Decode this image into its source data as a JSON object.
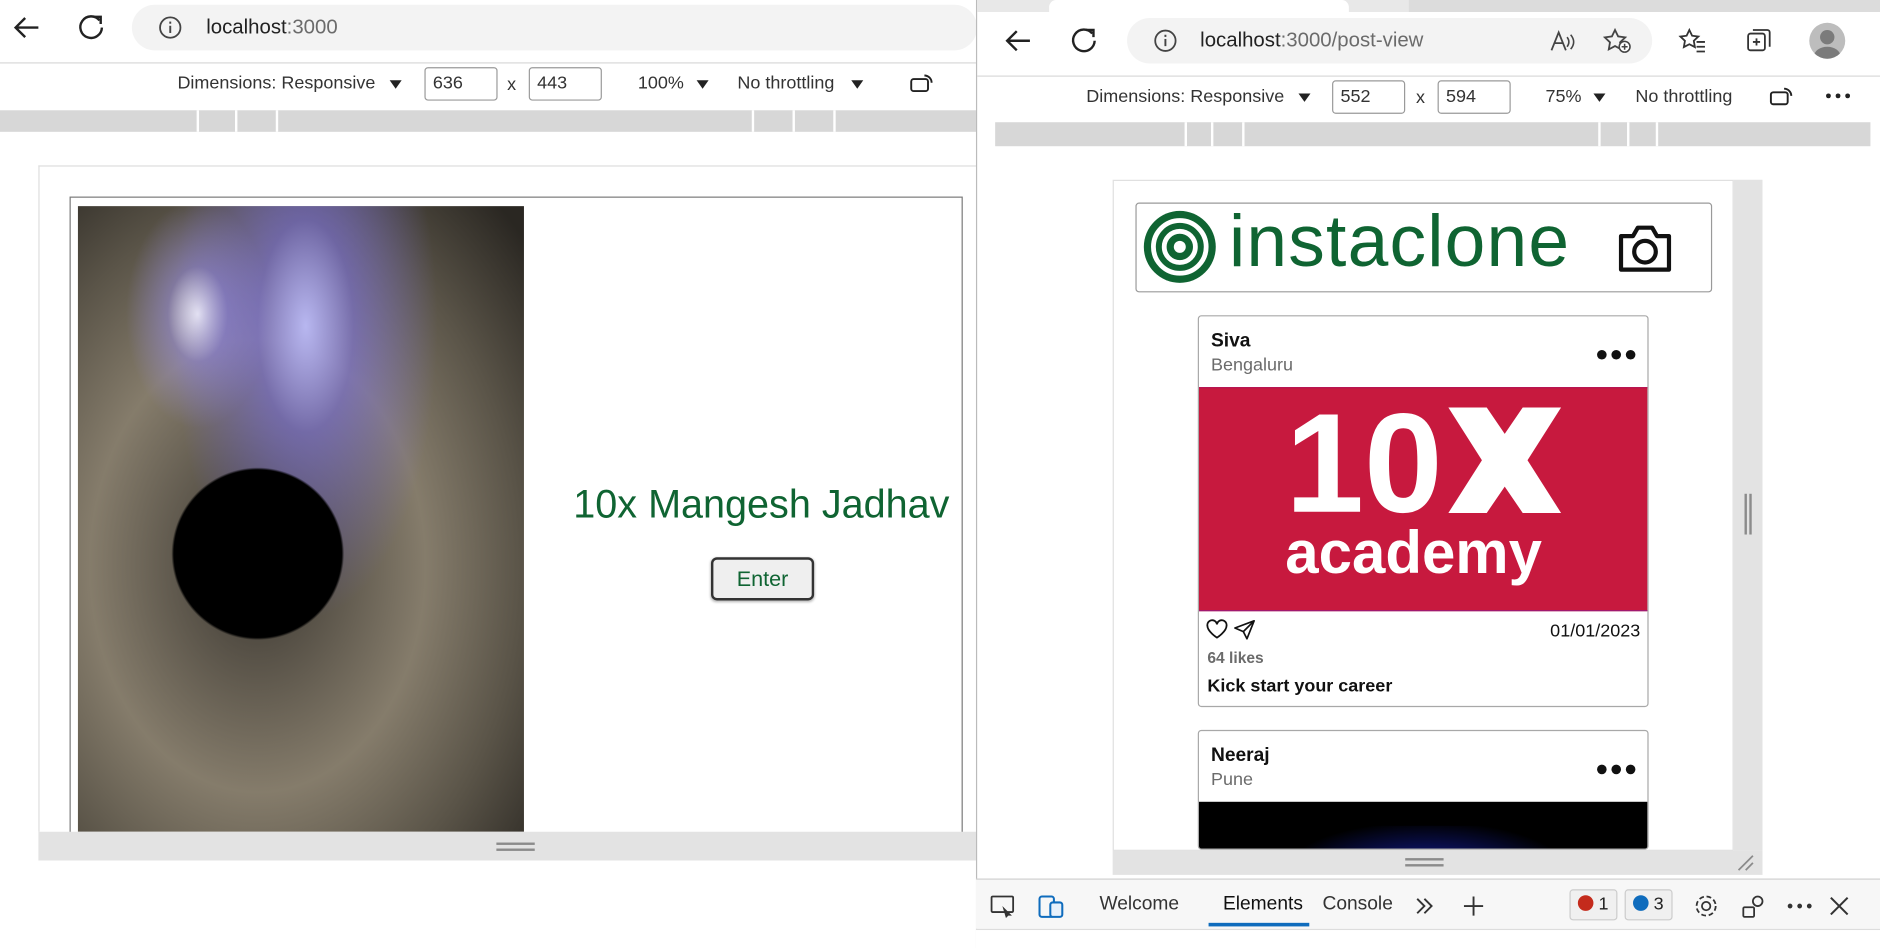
{
  "left_window": {
    "url_host": "localhost",
    "url_path": ":3000",
    "devtools_bar": {
      "dimensions_label": "Dimensions: Responsive",
      "width": "636",
      "x": "x",
      "height": "443",
      "zoom": "100%",
      "throttling": "No throttling"
    },
    "page": {
      "name": "10x Mangesh Jadhav",
      "enter_button": "Enter"
    }
  },
  "right_window": {
    "url_host": "localhost",
    "url_path": ":3000/post-view",
    "devtools_bar": {
      "dimensions_label": "Dimensions: Responsive",
      "width": "552",
      "x": "x",
      "height": "594",
      "zoom": "75%",
      "throttling": "No throttling"
    },
    "app": {
      "brand": "instaclone",
      "posts": [
        {
          "author": "Siva",
          "location": "Bengaluru",
          "image_text_top": "10",
          "image_text_bottom": "academy",
          "date": "01/01/2023",
          "likes": "64 likes",
          "description": "Kick start your career"
        },
        {
          "author": "Neeraj",
          "location": "Pune"
        }
      ]
    },
    "devtools_tabs": {
      "welcome": "Welcome",
      "elements": "Elements",
      "console": "Console",
      "errors": "1",
      "messages": "3"
    }
  },
  "colors": {
    "brand_green": "#0f6432",
    "post_image_red": "#c7193e",
    "active_tab_blue": "#0f6cbd"
  }
}
